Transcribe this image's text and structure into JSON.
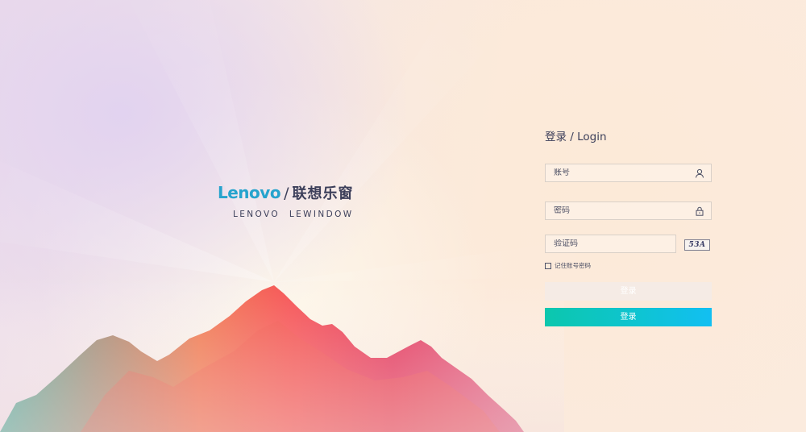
{
  "brand": {
    "logo": "Lenovo",
    "slash": "/",
    "name_cn": "联想乐窗",
    "subtitle": "LENOVO  LEWINDOW"
  },
  "login": {
    "title": "登录 / Login",
    "account_placeholder": "账号",
    "password_placeholder": "密码",
    "captcha_placeholder": "验证码",
    "captcha_text": "53A",
    "remember_label": "记住账号密码",
    "ghost_button_label": "登录",
    "login_button_label": "登录"
  },
  "colors": {
    "accent_start": "#0cc7ad",
    "accent_end": "#12bff2",
    "logo": "#26a3cd",
    "text": "#3c3f5a"
  },
  "icons": {
    "account": "user-icon",
    "password": "lock-icon"
  }
}
